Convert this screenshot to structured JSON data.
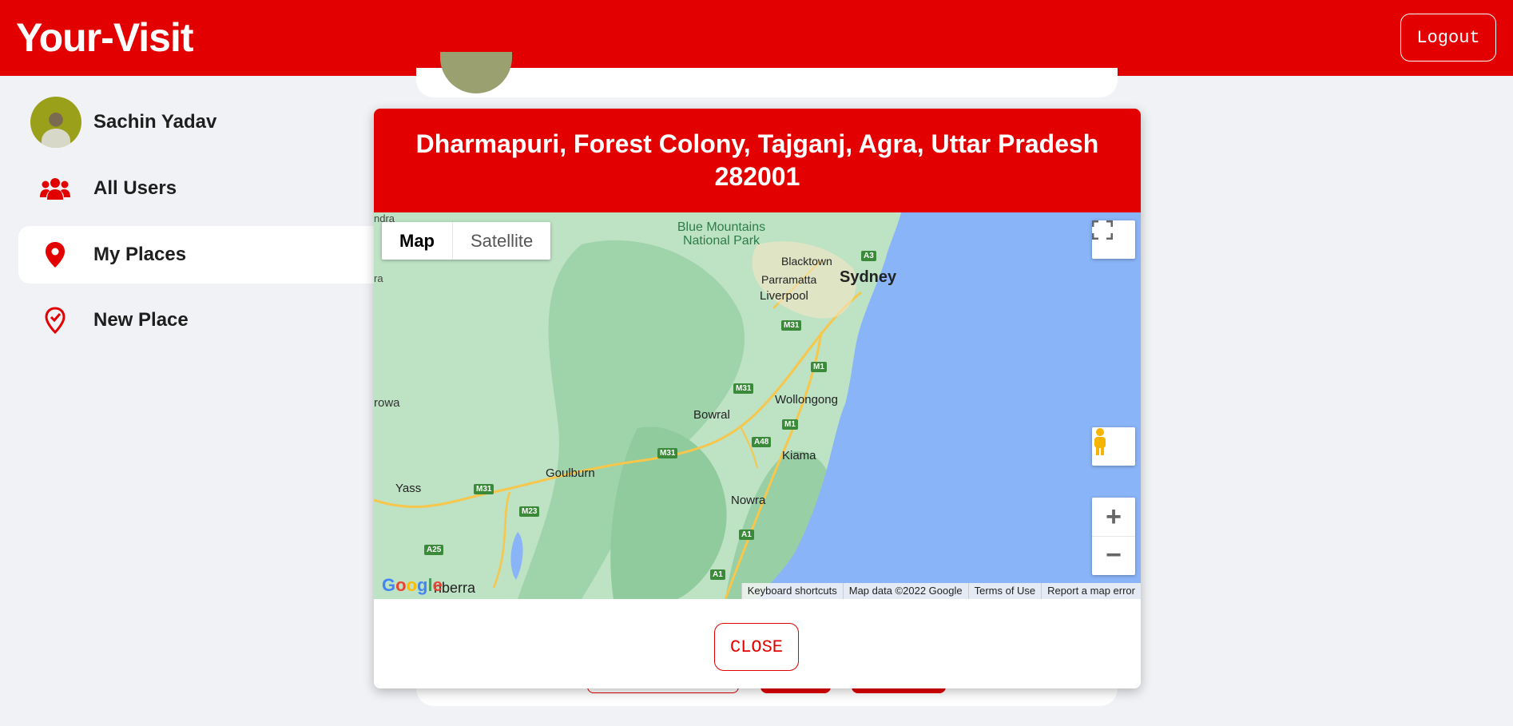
{
  "app": {
    "brand": "Your-Visit",
    "logout_label": "Logout",
    "accent_color": "#e20000"
  },
  "sidebar": {
    "items": [
      {
        "label": "Sachin Yadav",
        "icon": "avatar"
      },
      {
        "label": "All Users",
        "icon": "users-icon"
      },
      {
        "label": "My Places",
        "icon": "map-pin-icon",
        "active": true
      },
      {
        "label": "New Place",
        "icon": "pin-check-icon"
      }
    ]
  },
  "modal": {
    "title": "Dharmapuri, Forest Colony, Tajganj, Agra, Uttar Pradesh 282001",
    "close_label": "CLOSE"
  },
  "map": {
    "type_map": "Map",
    "type_satellite": "Satellite",
    "labels": {
      "blue_mountains": "Blue Mountains National Park",
      "blacktown": "Blacktown",
      "parramatta": "Parramatta",
      "sydney": "Sydney",
      "liverpool": "Liverpool",
      "wollongong": "Wollongong",
      "bowral": "Bowral",
      "kiama": "Kiama",
      "goulburn": "Goulburn",
      "yass": "Yass",
      "nowra": "Nowra",
      "canberra": "nberra",
      "rowa": "rowa",
      "ndra": "ndra",
      "ra": "ra"
    },
    "road_badges": [
      "A3",
      "M31",
      "M1",
      "M31",
      "M1",
      "A48",
      "M31",
      "M31",
      "M23",
      "A25",
      "A1",
      "A1"
    ],
    "google_logo": "Google",
    "footer": {
      "shortcuts": "Keyboard shortcuts",
      "map_data": "Map data ©2022 Google",
      "terms": "Terms of Use",
      "report": "Report a map error"
    },
    "zoom_in": "+",
    "zoom_out": "−"
  }
}
